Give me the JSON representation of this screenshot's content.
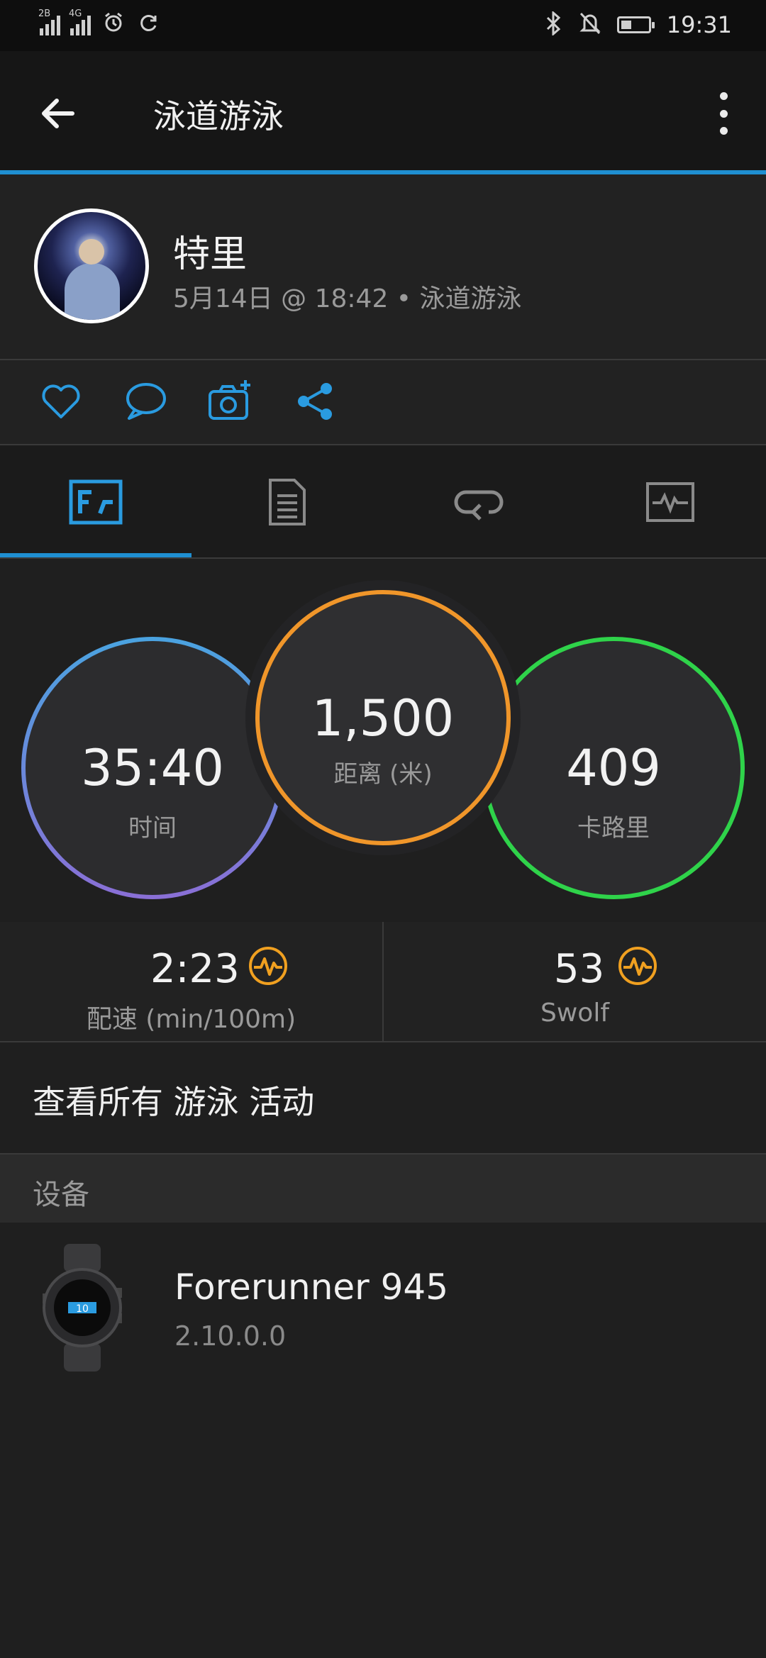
{
  "status_bar": {
    "clock": "19:31",
    "sim1": "2B",
    "sim2": "4G"
  },
  "app_bar": {
    "title": "泳道游泳"
  },
  "profile": {
    "name": "特里",
    "subtitle": "5月14日 @ 18:42 • 泳道游泳"
  },
  "actions": [
    "like-icon",
    "comment-icon",
    "add-photo-icon",
    "share-icon"
  ],
  "tabs": [
    "summary-icon",
    "details-icon",
    "laps-icon",
    "charts-icon"
  ],
  "metrics": {
    "time": {
      "value": "35:40",
      "label": "时间"
    },
    "distance": {
      "value": "1,500",
      "label": "距离 (米)"
    },
    "calories": {
      "value": "409",
      "label": "卡路里"
    }
  },
  "stats": {
    "pace": {
      "value": "2:23",
      "label": "配速 (min/100m)"
    },
    "swolf": {
      "value": "53",
      "label": "Swolf"
    }
  },
  "view_all": "查看所有 游泳 活动",
  "section_devices": "设备",
  "device": {
    "name": "Forerunner 945",
    "version": "2.10.0.0"
  },
  "colors": {
    "accent": "#1f8fd1",
    "time_ring": "#6a8fe0",
    "distance_ring": "#f0962a",
    "calories_ring": "#2fd34a",
    "pulse_icon": "#f0a020"
  }
}
